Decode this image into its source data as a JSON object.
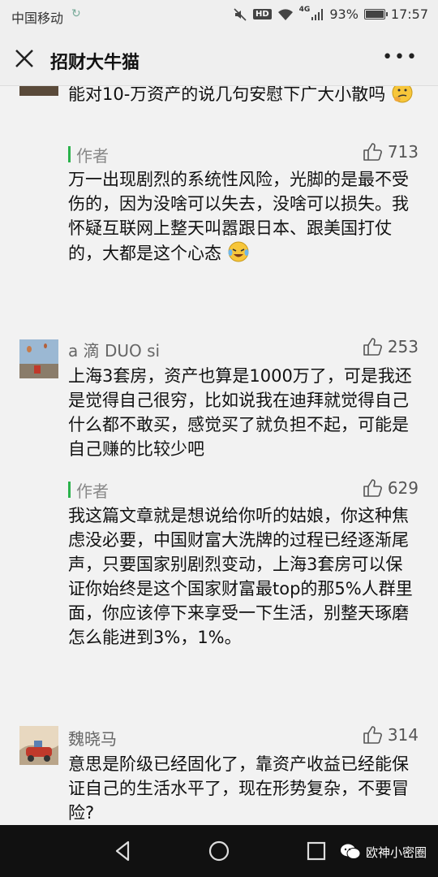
{
  "status": {
    "carrier": "中国移动",
    "hd": "HD",
    "network": "4G",
    "battery": "93%",
    "battery_level": 0.93,
    "time": "17:57"
  },
  "header": {
    "title": "招财大牛猫"
  },
  "comments": [
    {
      "text_tail": "能对10-万资产的说几句安慰下广大小散吗",
      "reply": {
        "label": "作者",
        "likes": "713",
        "text": "万一出现剧烈的系统性风险，光脚的是最不受伤的，因为没啥可以失去，没啥可以损失。我怀疑互联网上整天叫嚣跟日本、跟美国打仗的，大都是这个心态"
      }
    },
    {
      "nickname": "a 滴 DUO si",
      "likes": "253",
      "text": "上海3套房，资产也算是1000万了，可是我还是觉得自己很穷，比如说我在迪拜就觉得自己什么都不敢买，感觉买了就负担不起，可能是自己赚的比较少吧",
      "reply": {
        "label": "作者",
        "likes": "629",
        "text": "我这篇文章就是想说给你听的姑娘，你这种焦虑没必要，中国财富大洗牌的过程已经逐渐尾声，只要国家别剧烈变动，上海3套房可以保证你始终是这个国家财富最top的那5%人群里面，你应该停下来享受一下生活，别整天琢磨怎么能进到3%，1%。"
      }
    },
    {
      "nickname": "魏晓马",
      "likes": "314",
      "text": "意思是阶级已经固化了，靠资产收益已经能保证自己的生活水平了，现在形势复杂，不要冒险?"
    }
  ],
  "watermark": "欧神小密圈"
}
